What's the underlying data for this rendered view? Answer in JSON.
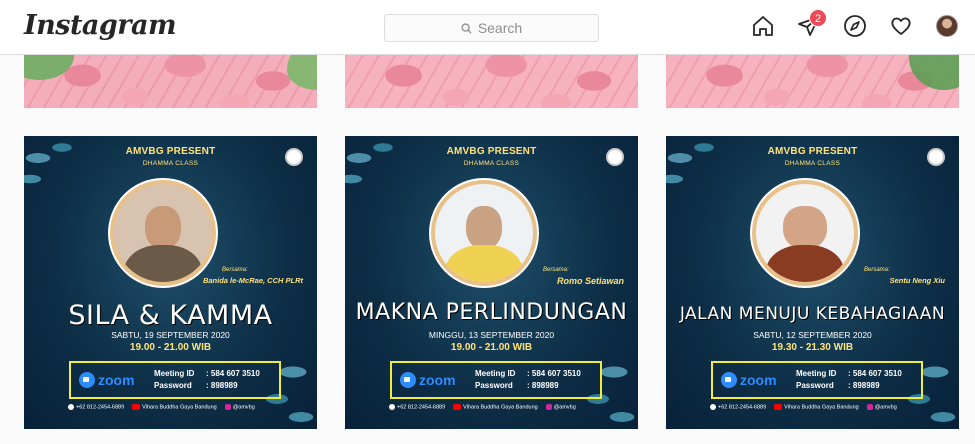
{
  "app": {
    "logo": "Instagram",
    "search_placeholder": "Search",
    "notifications_count": "2"
  },
  "nav": {
    "icons": [
      "home-icon",
      "direct-message-icon",
      "explore-icon",
      "activity-heart-icon",
      "profile-avatar"
    ]
  },
  "colors": {
    "accent": "#ed4956",
    "poster_bg": "#0e2f47",
    "poster_gold": "#ffe37a",
    "zoom_blue": "#2d8cff",
    "zoom_box": "#f3ec3a"
  },
  "posts": [
    {
      "present": "AMVBG PRESENT",
      "class": "DHAMMA CLASS",
      "with_label": "Bersama:",
      "speaker": "Banida le-McRae, CCH PLRt",
      "headline": "SILA & KAMMA",
      "date": "SABTU, 19 SEPTEMBER 2020",
      "time": "19.00 - 21.00 WIB",
      "zoom_label": "zoom",
      "meeting_id_label": "Meeting ID",
      "meeting_id": ": 584 607 3510",
      "password_label": "Password",
      "password": ": 898989",
      "phone": "+62 812-2454-6889",
      "youtube": "Vihara Buddha Gaya Bandung",
      "instagram": "@amvbg"
    },
    {
      "present": "AMVBG PRESENT",
      "class": "DHAMMA CLASS",
      "with_label": "Bersama:",
      "speaker": "Romo Setiawan",
      "headline": "MAKNA PERLINDUNGAN",
      "date": "MINGGU, 13 SEPTEMBER 2020",
      "time": "19.00 - 21.00 WIB",
      "zoom_label": "zoom",
      "meeting_id_label": "Meeting ID",
      "meeting_id": ": 584 607 3510",
      "password_label": "Password",
      "password": ": 898989",
      "phone": "+62 812-2454-6889",
      "youtube": "Vihara Buddha Gaya Bandung",
      "instagram": "@amvbg"
    },
    {
      "present": "AMVBG PRESENT",
      "class": "DHAMMA CLASS",
      "with_label": "Bersama:",
      "speaker": "Sentu Neng Xiu",
      "headline": "JALAN MENUJU KEBAHAGIAAN",
      "date": "SABTU, 12 SEPTEMBER 2020",
      "time": "19.30 - 21.30 WIB",
      "zoom_label": "zoom",
      "meeting_id_label": "Meeting ID",
      "meeting_id": ": 584 607 3510",
      "password_label": "Password",
      "password": ": 898989",
      "phone": "+62 812-2454-6889",
      "youtube": "Vihara Buddha Gaya Bandung",
      "instagram": "@amvbg"
    }
  ]
}
